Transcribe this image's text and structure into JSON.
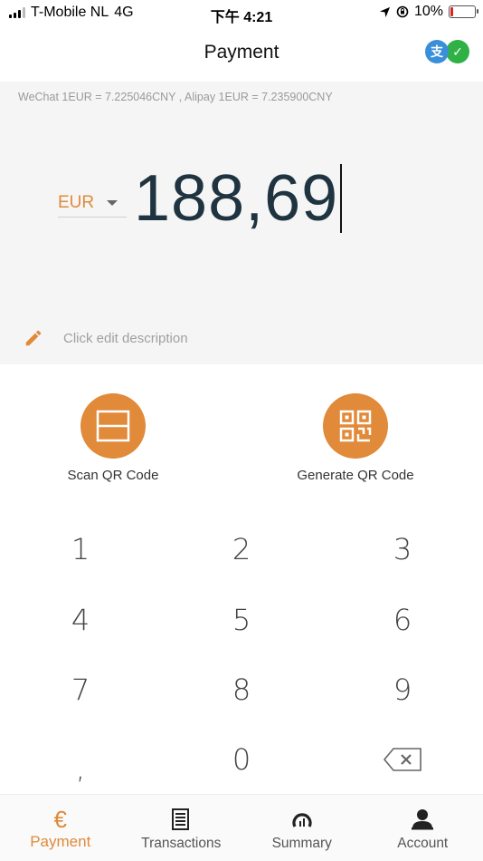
{
  "status_bar": {
    "carrier": "T-Mobile NL",
    "network": "4G",
    "time": "下午 4:21",
    "battery": "10%",
    "battery_level": 0.1
  },
  "header": {
    "title": "Payment",
    "alipay_glyph": "支",
    "wechat_glyph": "✓"
  },
  "rates": {
    "text": "WeChat 1EUR = 7.225046CNY , Alipay 1EUR = 7.235900CNY"
  },
  "amount": {
    "currency": "EUR",
    "value": "188,69"
  },
  "description": {
    "placeholder": "Click edit description"
  },
  "actions": {
    "scan_label": "Scan QR Code",
    "generate_label": "Generate QR Code"
  },
  "keypad": {
    "k1": "1",
    "k2": "2",
    "k3": "3",
    "k4": "4",
    "k5": "5",
    "k6": "6",
    "k7": "7",
    "k8": "8",
    "k9": "9",
    "comma": ",",
    "k0": "0"
  },
  "nav": {
    "items": [
      {
        "label": "Payment",
        "icon": "euro-icon",
        "glyph": "€",
        "active": true
      },
      {
        "label": "Transactions",
        "icon": "receipt-icon",
        "active": false
      },
      {
        "label": "Summary",
        "icon": "gauge-icon",
        "active": false
      },
      {
        "label": "Account",
        "icon": "user-icon",
        "active": false
      }
    ]
  },
  "colors": {
    "accent": "#e08a3a",
    "amount_text": "#1f3440",
    "panel_bg": "#f5f5f5"
  }
}
